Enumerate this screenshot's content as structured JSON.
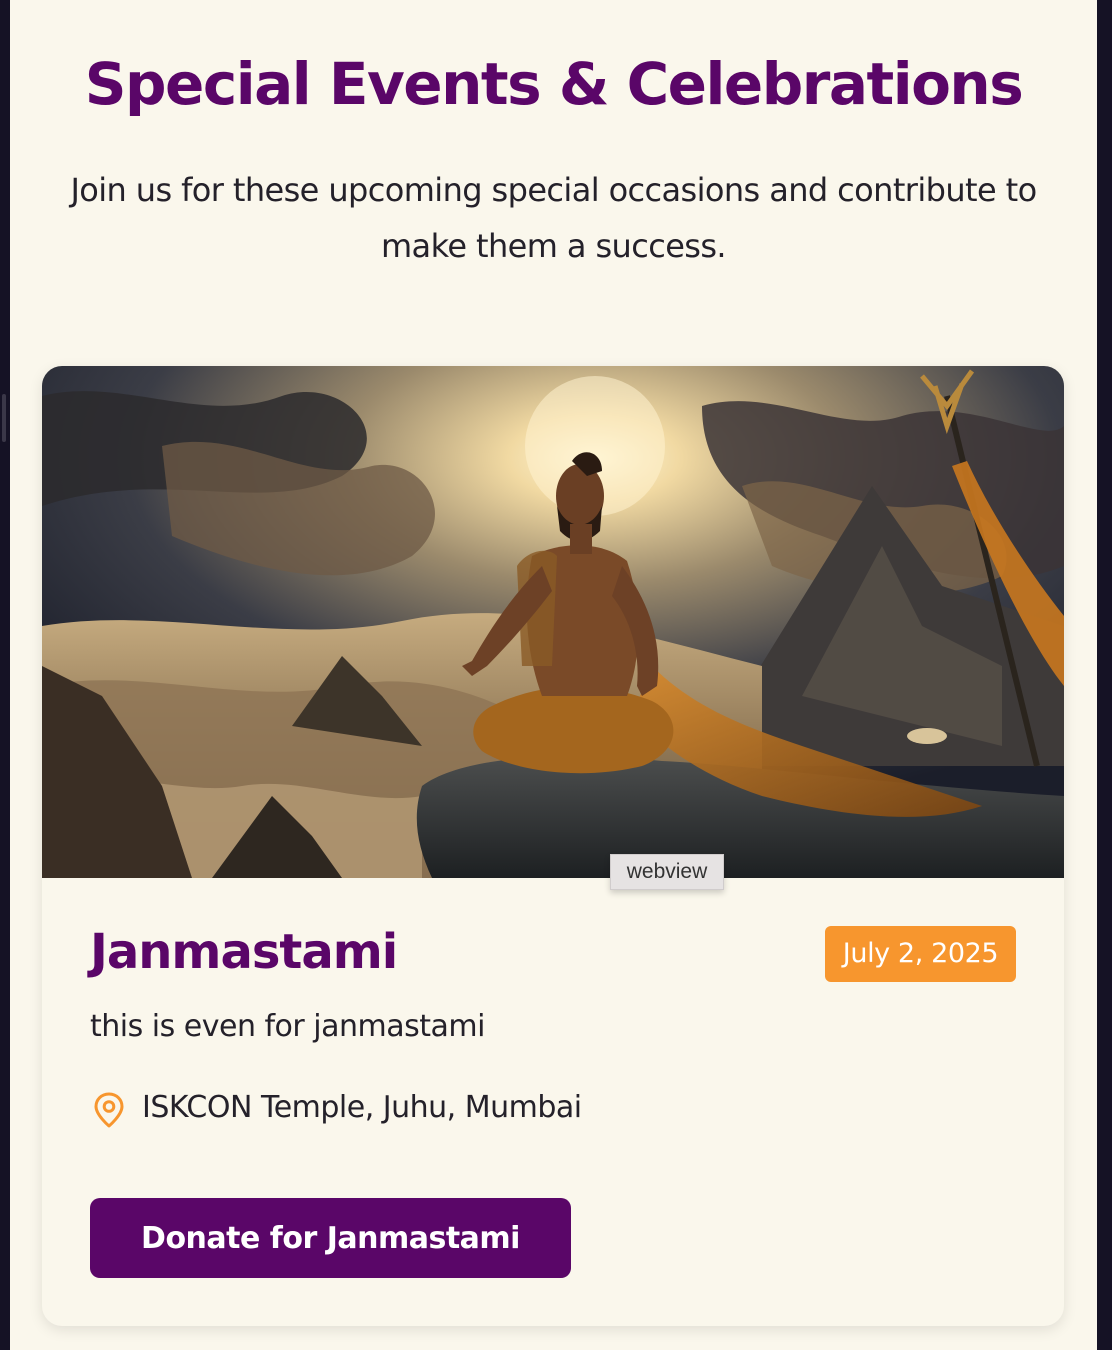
{
  "section": {
    "title": "Special Events & Celebrations",
    "subtitle": "Join us for these upcoming special occasions and contribute to make them a success."
  },
  "event": {
    "title": "Janmastami",
    "date": "July 2, 2025",
    "description": "this is even for janmastami",
    "location": "ISKCON Temple, Juhu, Mumbai",
    "button_label": "Donate for Janmastami",
    "image_label": "webview"
  },
  "colors": {
    "brand_purple": "#5a0668",
    "accent_orange": "#f7962e",
    "page_background": "#faf7ec"
  },
  "icons": {
    "location": "map-pin-icon"
  }
}
